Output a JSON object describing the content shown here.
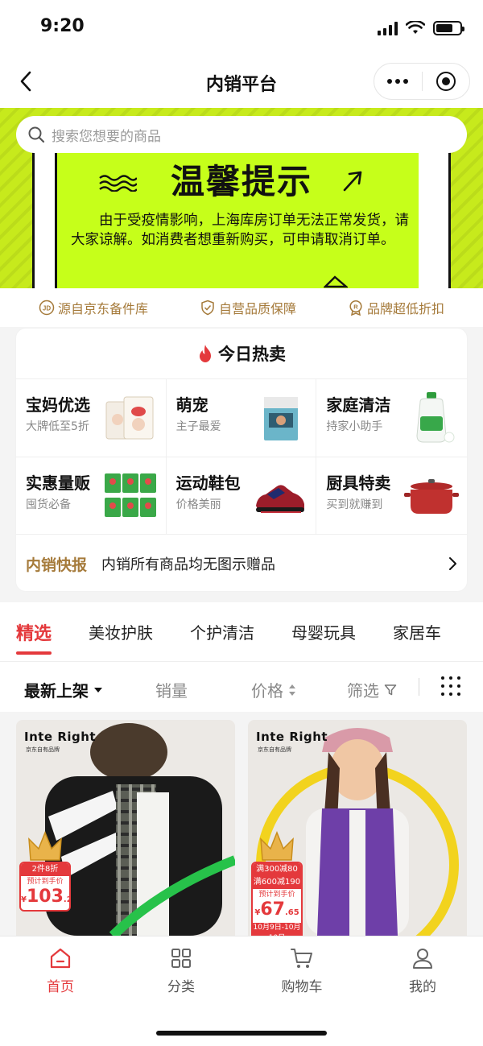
{
  "status_bar": {
    "time": "9:20"
  },
  "nav": {
    "title": "内销平台"
  },
  "search": {
    "placeholder": "搜索您想要的商品"
  },
  "banner": {
    "title": "温馨提示",
    "text": "由于受疫情影响，上海库房订单无法正常发货，请大家谅解。如消费者想重新购买，可申请取消订单。"
  },
  "guarantees": [
    {
      "label": "源自京东备件库",
      "icon": "jd-icon"
    },
    {
      "label": "自营品质保障",
      "icon": "shield-check-icon"
    },
    {
      "label": "品牌超低折扣",
      "icon": "discount-badge-icon"
    }
  ],
  "hot": {
    "title": "今日热卖",
    "items": [
      {
        "title": "宝妈优选",
        "subtitle": "大牌低至5折",
        "icon": "diaper-pack-icon"
      },
      {
        "title": "萌宠",
        "subtitle": "主子最爱",
        "icon": "pet-food-bag-icon"
      },
      {
        "title": "家庭清洁",
        "subtitle": "持家小助手",
        "icon": "detergent-bottle-icon"
      },
      {
        "title": "实惠量贩",
        "subtitle": "囤货必备",
        "icon": "detergent-bags-icon"
      },
      {
        "title": "运动鞋包",
        "subtitle": "价格美丽",
        "icon": "sneaker-icon"
      },
      {
        "title": "厨具特卖",
        "subtitle": "买到就赚到",
        "icon": "cooking-pot-icon"
      }
    ],
    "flash_label": "内销快报",
    "flash_text": "内销所有商品均无图示赠品"
  },
  "tabs": [
    "精选",
    "美妆护肤",
    "个护清洁",
    "母婴玩具",
    "家居车"
  ],
  "active_tab": 0,
  "sort": {
    "latest": "最新上架",
    "sales": "销量",
    "price": "价格",
    "filter": "筛选"
  },
  "products": [
    {
      "brand": "Inte Right",
      "brand_sub": "京东自有品牌",
      "promo": "2件8折",
      "price_label": "预计到手价",
      "price_symbol": "¥",
      "price_int": "103",
      "price_dec": ".20"
    },
    {
      "brand": "Inte Right",
      "brand_sub": "京东自有品牌",
      "promo_lines": [
        "满300减80",
        "满600减190"
      ],
      "price_label": "预计到手价",
      "price_symbol": "¥",
      "price_int": "67",
      "price_dec": ".65",
      "date": "10月9日-10月10日"
    }
  ],
  "bottom_tabs": [
    {
      "label": "首页",
      "icon": "home-icon"
    },
    {
      "label": "分类",
      "icon": "category-grid-icon"
    },
    {
      "label": "购物车",
      "icon": "cart-icon"
    },
    {
      "label": "我的",
      "icon": "profile-icon"
    }
  ],
  "colors": {
    "accent": "#e4393c",
    "gold": "#a57a3a",
    "banner": "#c6ff1a"
  }
}
